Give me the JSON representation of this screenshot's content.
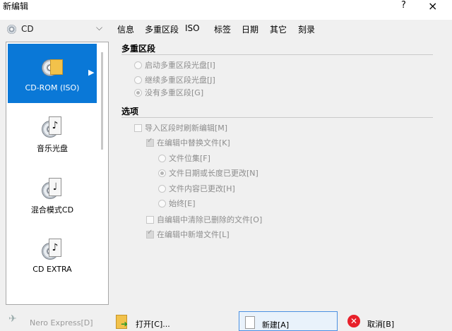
{
  "window": {
    "title": "新编辑",
    "help_label": "?",
    "close_label": "×"
  },
  "source_combo": {
    "value": "CD"
  },
  "tabs": [
    {
      "label": "信息"
    },
    {
      "label": "多重区段"
    },
    {
      "label": "ISO"
    },
    {
      "label": "标签"
    },
    {
      "label": "日期"
    },
    {
      "label": "其它"
    },
    {
      "label": "刻录"
    }
  ],
  "project_types": [
    {
      "label": "CD-ROM (ISO)",
      "icon": "cdrom-iso-icon",
      "selected": true
    },
    {
      "label": "音乐光盘",
      "icon": "music-disc-icon"
    },
    {
      "label": "混合模式CD",
      "icon": "mixed-mode-cd-icon"
    },
    {
      "label": "CD EXTRA",
      "icon": "cd-extra-icon"
    }
  ],
  "multisession": {
    "title": "多重区段",
    "options": [
      {
        "label": "启动多重区段光盘[I]"
      },
      {
        "label": "继续多重区段光盘[J]"
      },
      {
        "label": "没有多重区段[G]",
        "selected": true
      }
    ]
  },
  "options": {
    "title": "选项",
    "import_refresh": {
      "label": "导入区段时刷新编辑[M]"
    },
    "replace_in_edit": {
      "label": "在编辑中替换文件[K]"
    },
    "replace_modes": [
      {
        "label": "文件位集[F]"
      },
      {
        "label": "文件日期或长度已更改[N]",
        "selected": true
      },
      {
        "label": "文件内容已更改[H]"
      },
      {
        "label": "始终[E]"
      }
    ],
    "remove_deleted": {
      "label": "自编辑中清除已删除的文件[O]"
    },
    "add_new": {
      "label": "在编辑中新增文件[L]"
    }
  },
  "buttons": {
    "nero_express": "Nero Express[D]",
    "open": "打开[C]...",
    "new": "新建[A]",
    "cancel": "取消[B]"
  }
}
